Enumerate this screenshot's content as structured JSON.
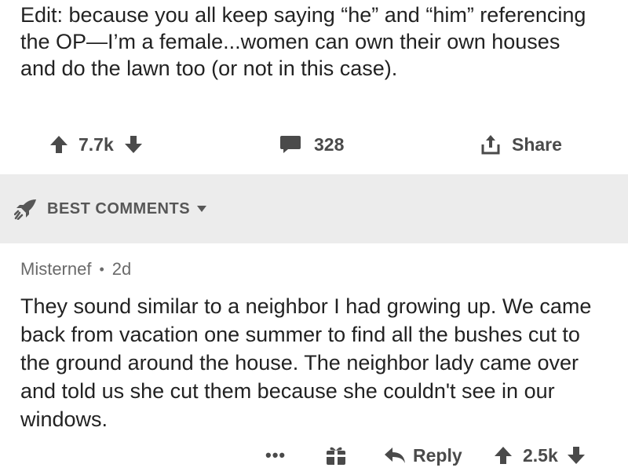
{
  "post": {
    "body": "Edit: because you all keep saying “he” and “him” referencing the OP—I’m a female...women can own their own houses and do the lawn too (or not in this case).",
    "votes": "7.7k",
    "comments": "328",
    "share_label": "Share"
  },
  "sort_bar": {
    "label": "BEST COMMENTS"
  },
  "comment": {
    "author": "Misternef",
    "separator": "•",
    "age": "2d",
    "body": "They sound similar to a neighbor I had growing up. We came back from vacation one summer to find all the bushes cut to the ground around the house. The neighbor lady came over and told us she cut them because she couldn't see in our windows.",
    "more_label": "•••",
    "reply_label": "Reply",
    "votes": "2.5k"
  },
  "colors": {
    "text": "#222222",
    "muted": "#6a6a6a",
    "icon": "#4a4a4a",
    "bar_bg": "#ececec"
  },
  "icons": [
    "upvote-icon",
    "downvote-icon",
    "comment-icon",
    "share-icon",
    "rocket-icon",
    "caret-down-icon",
    "gift-icon",
    "reply-icon"
  ]
}
